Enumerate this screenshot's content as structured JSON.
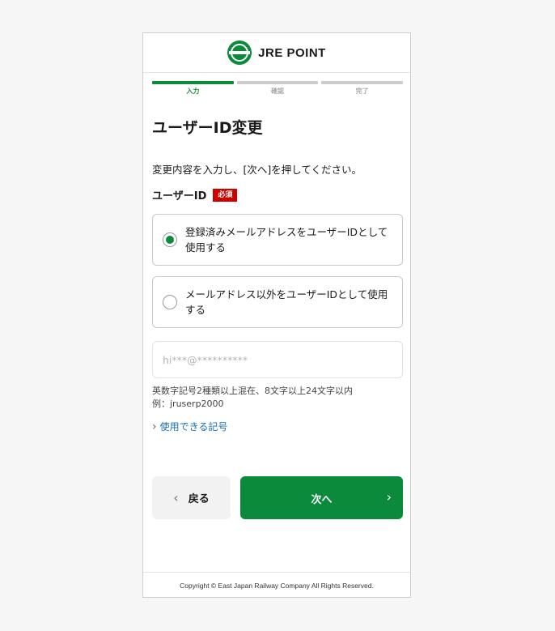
{
  "header": {
    "logo_text": "JRE POINT"
  },
  "steps": [
    {
      "label": "入力",
      "active": true
    },
    {
      "label": "確認",
      "active": false
    },
    {
      "label": "完了",
      "active": false
    }
  ],
  "page_title": "ユーザーID変更",
  "instruction": "変更内容を入力し、[次へ]を押してください。",
  "field": {
    "label": "ユーザーID",
    "required_badge": "必須"
  },
  "options": [
    {
      "label": "登録済みメールアドレスをユーザーIDとして使用する",
      "selected": true
    },
    {
      "label": "メールアドレス以外をユーザーIDとして使用する",
      "selected": false
    }
  ],
  "user_id_input": {
    "placeholder": "hi***@**********",
    "value": ""
  },
  "hint": {
    "line1": "英数字記号2種類以上混在、8文字以上24文字以内",
    "line2": "例：jruserp2000"
  },
  "symbols_link": "使用できる記号",
  "buttons": {
    "back_label": "戻る",
    "next_label": "次へ"
  },
  "footer": {
    "copyright": "Copyright © East Japan Railway Company All Rights Reserved."
  },
  "colors": {
    "accent": "#0b8a3c",
    "required": "#cc0000",
    "link": "#1a6fb5"
  }
}
